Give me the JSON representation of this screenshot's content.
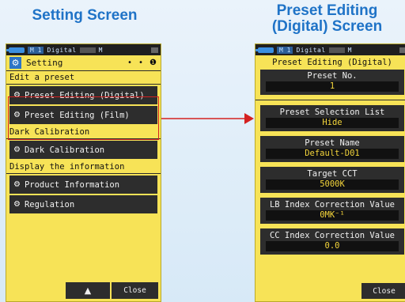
{
  "captions": {
    "left": "Setting Screen",
    "right_line1": "Preset Editing",
    "right_line2": "(Digital) Screen"
  },
  "status_bar": {
    "mode": "M 1",
    "label": "Digital",
    "mark": "M"
  },
  "setting_screen": {
    "title": "Setting",
    "page_dots": "• • ❶",
    "sections": [
      {
        "label": "Edit a preset",
        "items": [
          "Preset Editing (Digital)",
          "Preset Editing (Film)"
        ]
      },
      {
        "label": "Dark Calibration",
        "items": [
          "Dark Calibration"
        ]
      },
      {
        "label": "Display the information",
        "items": [
          "Product Information",
          "Regulation"
        ]
      }
    ],
    "up_button": "▲",
    "close_button": "Close"
  },
  "preset_screen": {
    "title": "Preset Editing (Digital)",
    "fields": [
      {
        "label": "Preset No.",
        "value": "1"
      },
      {
        "label": "Preset Selection List",
        "value": "Hide"
      },
      {
        "label": "Preset Name",
        "value": "Default-D01"
      },
      {
        "label": "Target CCT",
        "value": "5000K"
      },
      {
        "label": "LB Index Correction Value",
        "value": "0MK⁻¹"
      },
      {
        "label": "CC Index Correction Value",
        "value": "0.0"
      }
    ],
    "close_button": "Close"
  },
  "colors": {
    "screen_bg": "#f7e357",
    "button_bg": "#2d2d2d",
    "value_text": "#f4d53b",
    "highlight": "#d42020",
    "caption": "#1f73c7"
  }
}
